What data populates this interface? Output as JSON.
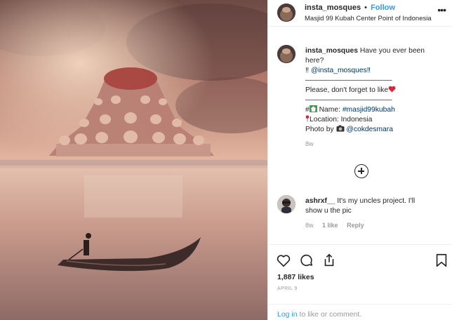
{
  "post": {
    "username": "insta_mosques",
    "separator": "•",
    "follow_label": "Follow",
    "location": "Masjid 99 Kubah Center Point of Indonesia",
    "more_icon": "ellipsis-icon"
  },
  "caption": {
    "username": "insta_mosques",
    "line1": "Have you ever been",
    "line2": "here?",
    "line3_prefix": "‼",
    "line3_mention": "@insta_mosques‼",
    "divider1": "————————————",
    "line5": "Please, don't forget to like",
    "divider2": "————————————",
    "hashtag_prefix": "#",
    "name_label": "Name:",
    "name_tag": "#masjid99kubah",
    "location_line": "Location: Indonesia",
    "photo_by_label": "Photo by",
    "photo_by_mention": "@cokdesmara",
    "time": "8w"
  },
  "comment": {
    "username": "ashrxf__",
    "text_line1": "It's my uncles project. I'll",
    "text_line2": "show u the pic",
    "time": "8w",
    "likes": "1 like",
    "reply": "Reply"
  },
  "likes_count": "1,887 likes",
  "post_date": "APRIL 9",
  "login": {
    "link": "Log in",
    "text": "to like or comment."
  },
  "colors": {
    "link_blue": "#3897f0",
    "mention_blue": "#003569",
    "heart_red": "#d7263d",
    "muted": "#999999"
  }
}
